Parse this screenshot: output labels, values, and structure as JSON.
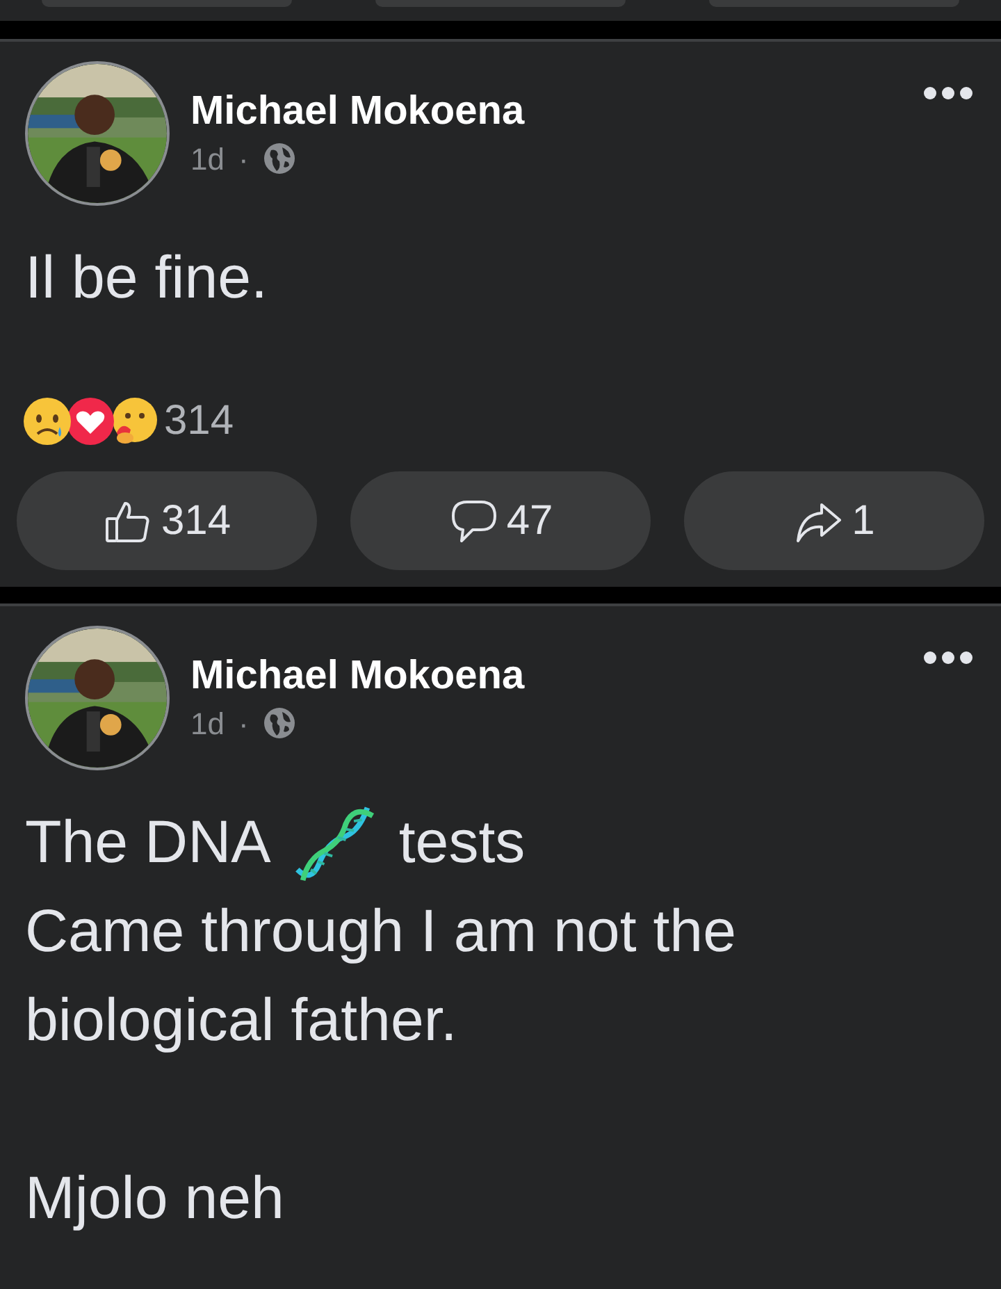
{
  "posts": [
    {
      "author": "Michael Mokoena",
      "time": "1d",
      "separator": "·",
      "blocks": [
        {
          "kind": "line",
          "parts": [
            {
              "kind": "text",
              "text": "Il be fine."
            }
          ]
        }
      ],
      "reactions": {
        "icons": [
          {
            "kind": "sad"
          },
          {
            "kind": "love"
          },
          {
            "kind": "care"
          }
        ],
        "count": "314"
      },
      "actions": [
        {
          "kind": "like",
          "count": "314"
        },
        {
          "kind": "comment",
          "count": "47"
        },
        {
          "kind": "share",
          "count": "1"
        }
      ]
    },
    {
      "author": "Michael Mokoena",
      "time": "1d",
      "separator": "·",
      "blocks": [
        {
          "kind": "line",
          "parts": [
            {
              "kind": "text",
              "text": "The DNA"
            },
            {
              "kind": "dna"
            },
            {
              "kind": "text",
              "text": "tests"
            }
          ]
        },
        {
          "kind": "line",
          "parts": [
            {
              "kind": "text",
              "text": "Came through I am not the biological father."
            }
          ]
        },
        {
          "kind": "blank"
        },
        {
          "kind": "line",
          "parts": [
            {
              "kind": "text",
              "text": "Mjolo neh"
            }
          ]
        }
      ]
    }
  ]
}
